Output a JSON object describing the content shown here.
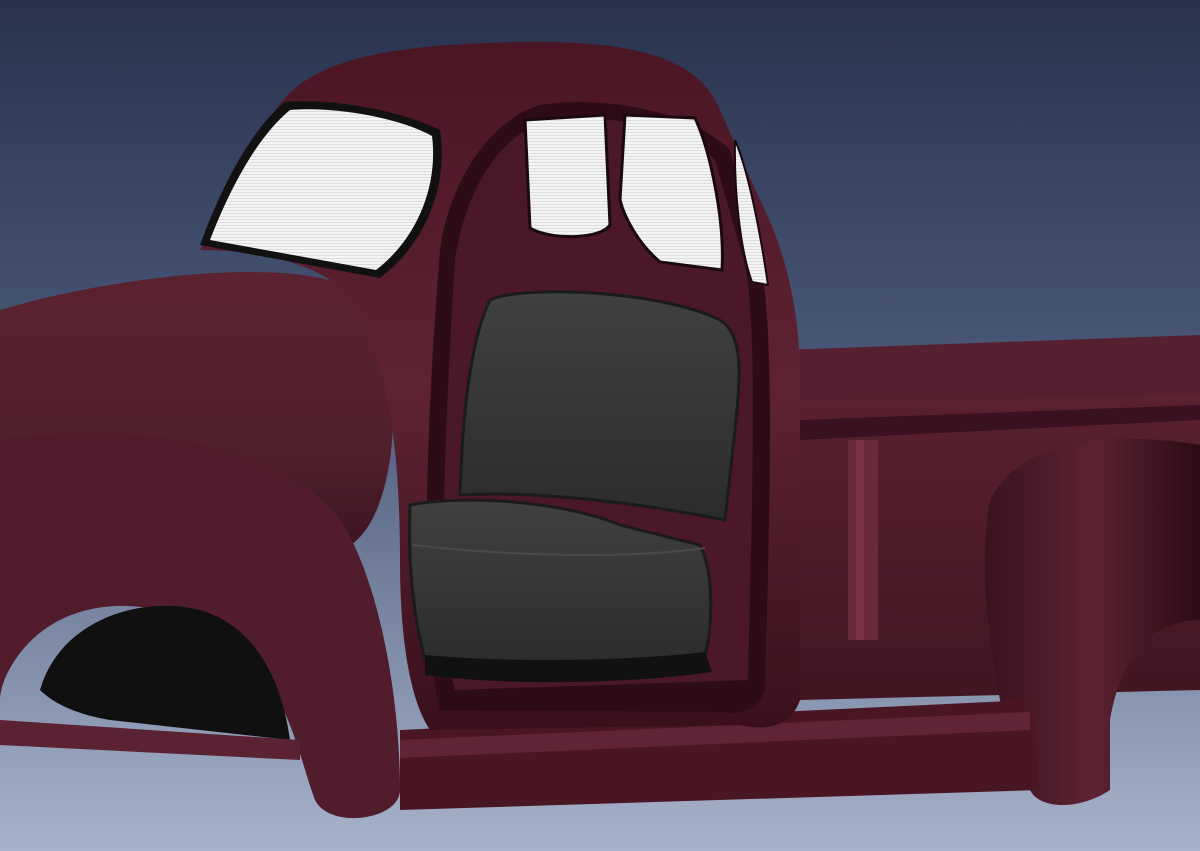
{
  "scene": {
    "subject_icon": "truck-icon",
    "colors": {
      "background_top": "#2b3550",
      "background_bottom": "#a3b0c8",
      "body_paint": "#5a2130",
      "body_shadow": "#2d0c16",
      "glass": "#f2f2f2",
      "seat": "#3a3a3a",
      "seat_shadow": "#1c1c1c",
      "wheel_well": "#121212"
    }
  }
}
